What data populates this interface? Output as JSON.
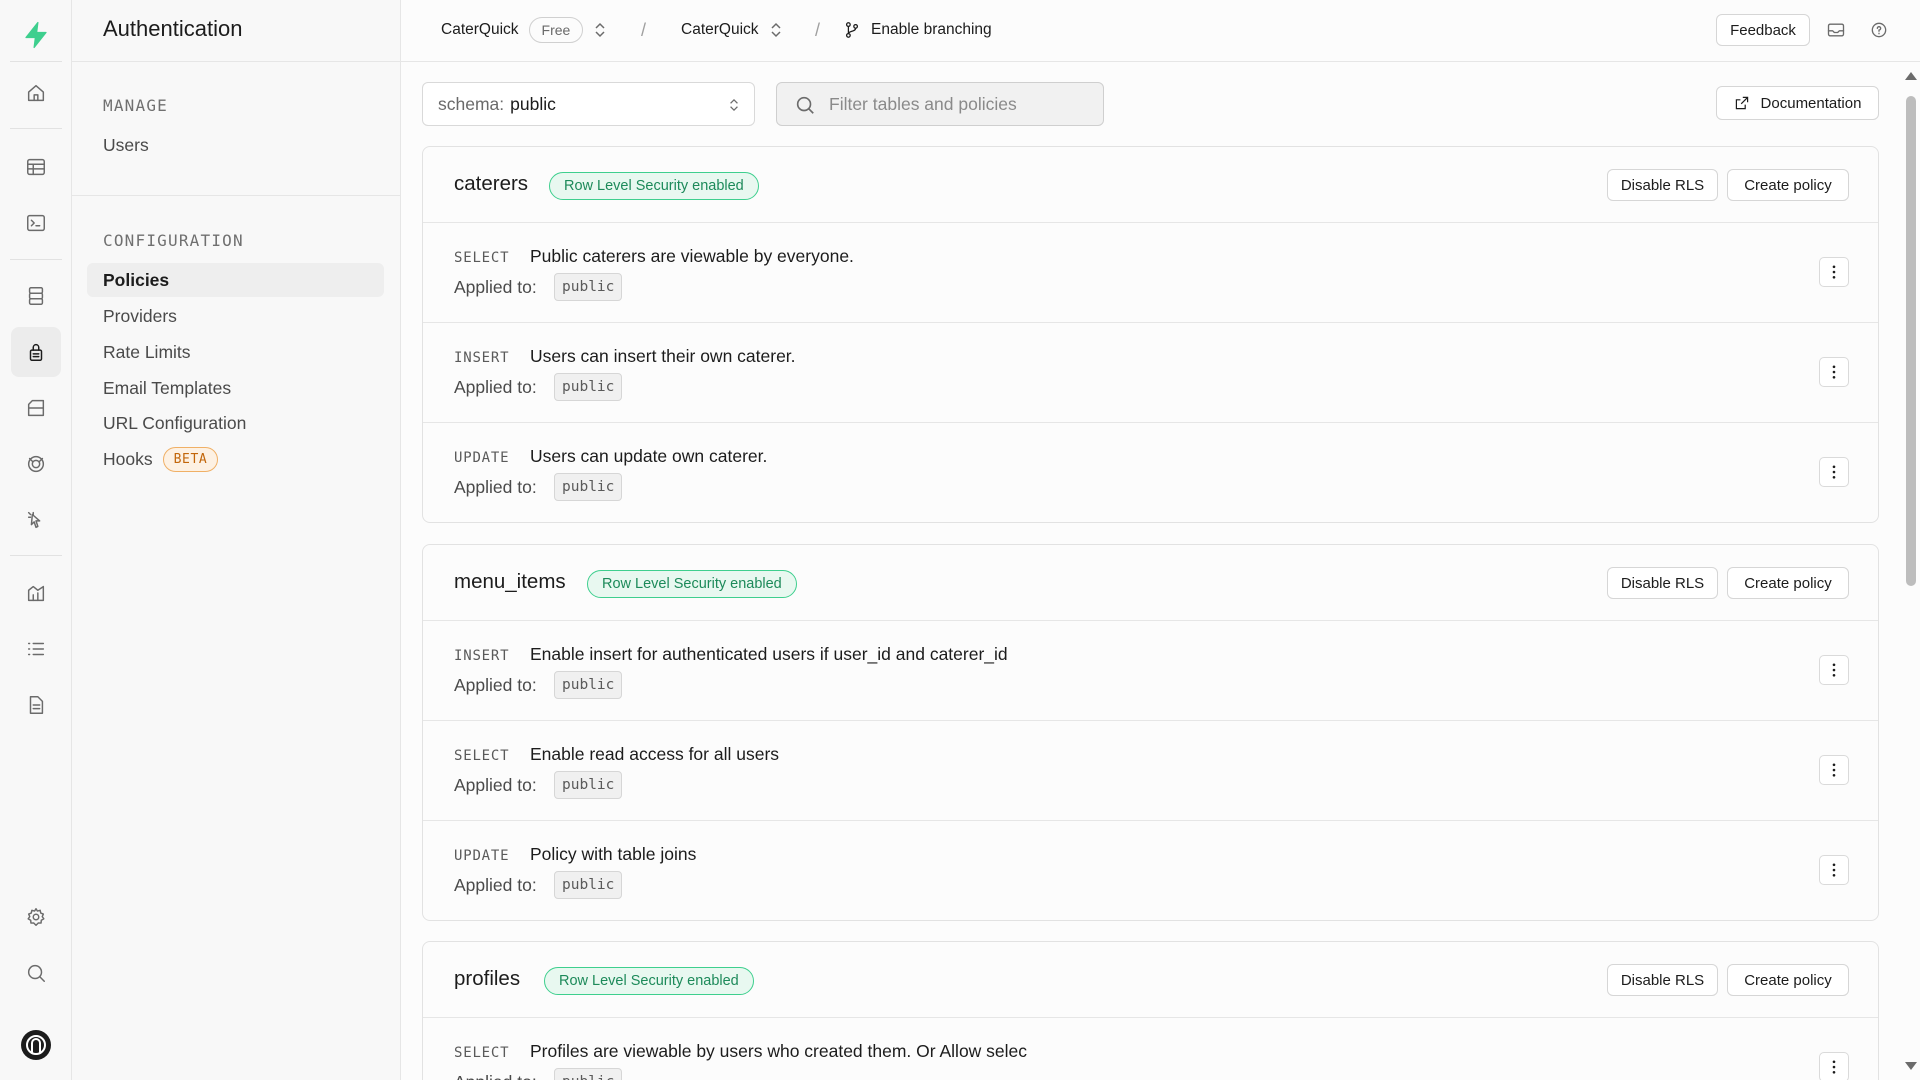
{
  "sidebar": {
    "title": "Authentication",
    "sections": [
      {
        "title": "MANAGE",
        "items": [
          {
            "label": "Users"
          }
        ]
      },
      {
        "title": "CONFIGURATION",
        "items": [
          {
            "label": "Policies",
            "active": true
          },
          {
            "label": "Providers"
          },
          {
            "label": "Rate Limits"
          },
          {
            "label": "Email Templates"
          },
          {
            "label": "URL Configuration"
          },
          {
            "label": "Hooks",
            "badge": "BETA"
          }
        ]
      }
    ]
  },
  "rail": {
    "items": [
      "home-icon",
      "table-editor-icon",
      "sql-editor-icon",
      "database-icon",
      "authentication-icon",
      "storage-icon",
      "realtime-icon",
      "edge-functions-icon",
      "reports-icon",
      "logs-icon",
      "api-docs-icon",
      "settings-icon",
      "search-icon",
      "user-avatar-icon"
    ]
  },
  "topbar": {
    "org": "CaterQuick",
    "plan": "Free",
    "project": "CaterQuick",
    "branching": "Enable branching",
    "feedback": "Feedback"
  },
  "toolbar": {
    "schema_prefix": "schema:",
    "schema_value": "public",
    "filter_placeholder": "Filter tables and policies",
    "documentation": "Documentation"
  },
  "tables": [
    {
      "name": "caterers",
      "rls_label": "Row Level Security enabled",
      "disable_label": "Disable RLS",
      "create_label": "Create policy",
      "policies": [
        {
          "command": "SELECT",
          "name": "Public caterers are viewable by everyone.",
          "applied_label": "Applied to:",
          "role": "public"
        },
        {
          "command": "INSERT",
          "name": "Users can insert their own caterer.",
          "applied_label": "Applied to:",
          "role": "public"
        },
        {
          "command": "UPDATE",
          "name": "Users can update own caterer.",
          "applied_label": "Applied to:",
          "role": "public"
        }
      ]
    },
    {
      "name": "menu_items",
      "rls_label": "Row Level Security enabled",
      "disable_label": "Disable RLS",
      "create_label": "Create policy",
      "policies": [
        {
          "command": "INSERT",
          "name": "Enable insert for authenticated users if user_id and caterer_id",
          "applied_label": "Applied to:",
          "role": "public"
        },
        {
          "command": "SELECT",
          "name": "Enable read access for all users",
          "applied_label": "Applied to:",
          "role": "public"
        },
        {
          "command": "UPDATE",
          "name": "Policy with table joins",
          "applied_label": "Applied to:",
          "role": "public"
        }
      ]
    },
    {
      "name": "profiles",
      "rls_label": "Row Level Security enabled",
      "disable_label": "Disable RLS",
      "create_label": "Create policy",
      "policies": [
        {
          "command": "SELECT",
          "name": "Profiles are viewable by users who created them. Or Allow selec",
          "applied_label": "Applied to:",
          "role": "public"
        }
      ]
    }
  ],
  "colors": {
    "brand": "#3ecf8e",
    "badge_bg": "#e8f8f0",
    "badge_text": "#1d8a5a",
    "beta_border": "#f0b066",
    "beta_text": "#c2660a"
  }
}
